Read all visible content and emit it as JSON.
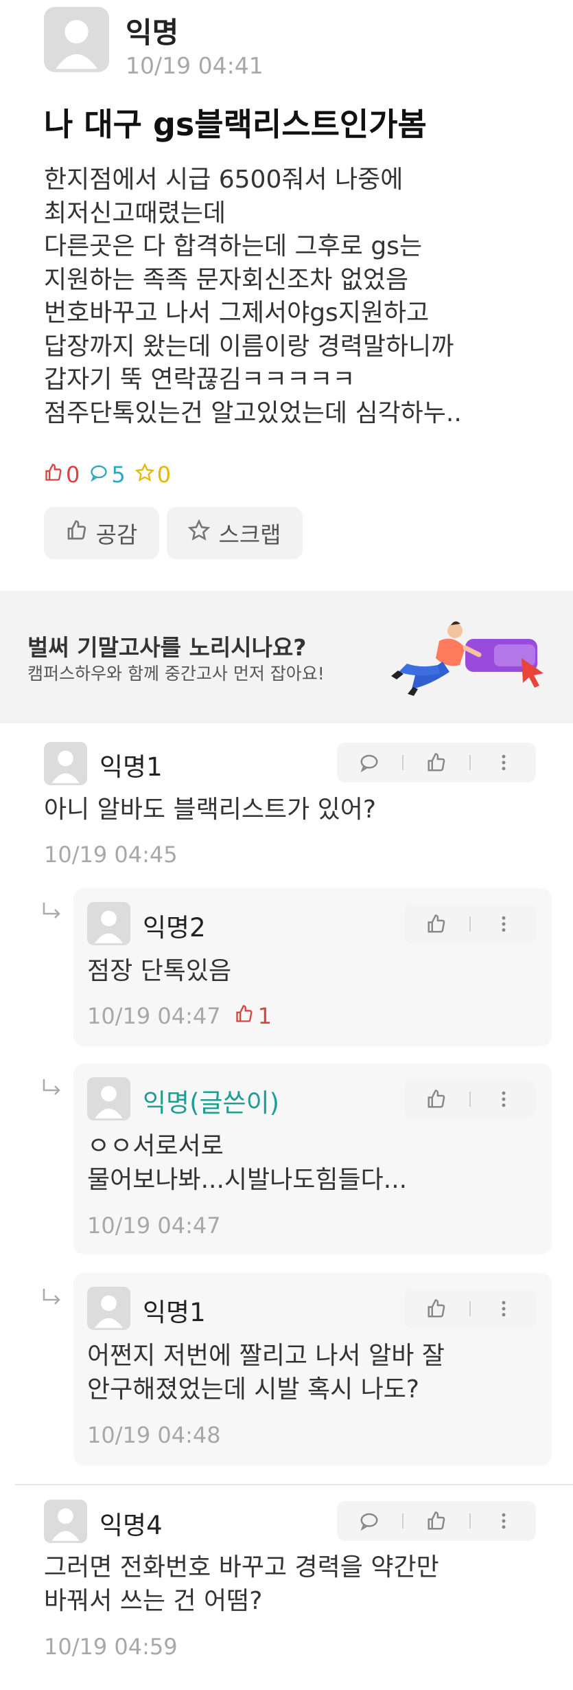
{
  "post": {
    "author": "익명",
    "time": "10/19 04:41",
    "title": "나 대구 gs블랙리스트인가봄",
    "body": "한지점에서 시급 6500줘서 나중에\n최저신고때렸는데\n다른곳은 다 합격하는데 그후로 gs는\n지원하는 족족 문자회신조차 없었음\n번호바꾸고 나서 그제서야gs지원하고\n답장까지 왔는데 이름이랑 경력말하니까\n갑자기 뚝 연락끊김ㅋㅋㅋㅋㅋ\n점주단톡있는건 알고있었는데 심각하누..",
    "likes": "0",
    "comments": "5",
    "scraps": "0",
    "empathy_label": "공감",
    "scrap_label": "스크랩"
  },
  "banner": {
    "title": "벌써 기말고사를 노리시나요?",
    "subtitle": "캠퍼스하우와 함께 중간고사 먼저 잡아요!"
  },
  "comments": [
    {
      "author": "익명1",
      "text": "아니 알바도 블랙리스트가 있어?",
      "time": "10/19 04:45"
    },
    {
      "author": "익명2",
      "text": "점장 단톡있음",
      "time": "10/19 04:47",
      "likes": "1"
    },
    {
      "author": "익명(글쓴이)",
      "text": "ㅇㅇ서로서로\n물어보나봐...시발나도힘들다...",
      "time": "10/19 04:47"
    },
    {
      "author": "익명1",
      "text": "어쩐지 저번에 짤리고 나서 알바 잘\n안구해졌었는데 시발 혹시 나도?",
      "time": "10/19 04:48"
    },
    {
      "author": "익명4",
      "text": "그러면 전화번호 바꾸고 경력을 약간만\n바꿔서 쓰는 건 어떰?",
      "time": "10/19 04:59"
    }
  ],
  "colors": {
    "like": "#d7433f",
    "comment": "#29a9c6",
    "scrap": "#e5b800",
    "writer": "#1f9d92"
  }
}
